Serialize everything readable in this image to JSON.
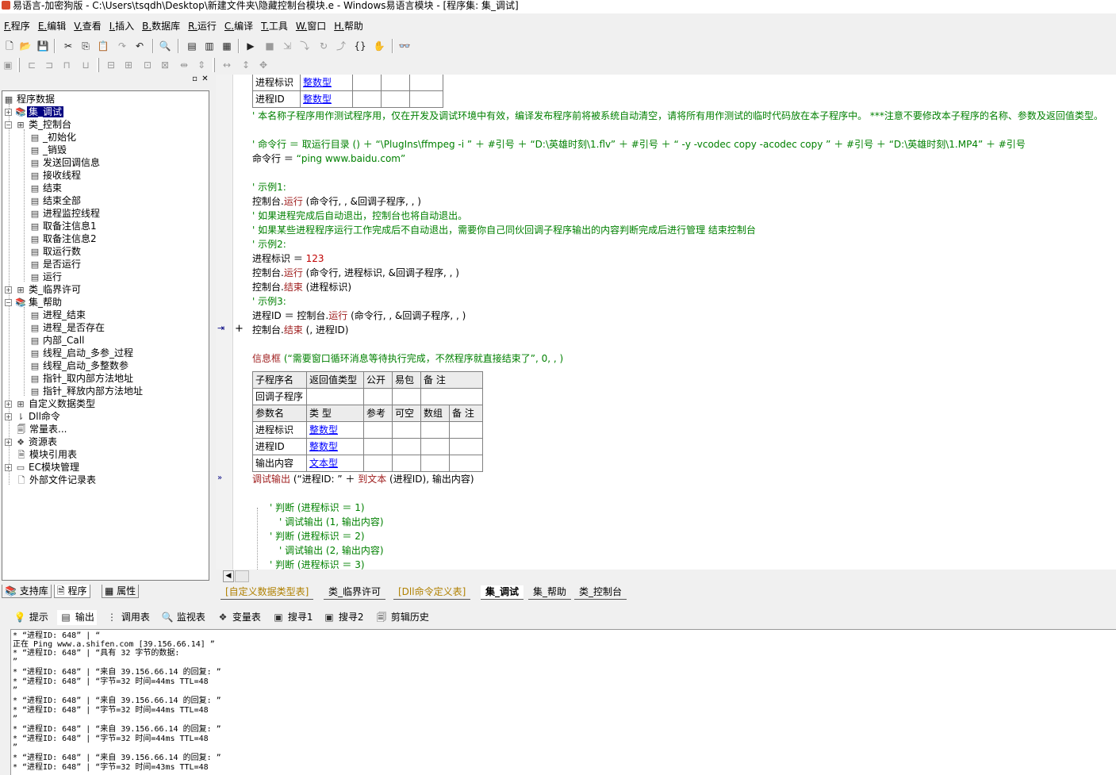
{
  "window": {
    "title": "易语言-加密狗版 - C:\\Users\\tsqdh\\Desktop\\新建文件夹\\隐藏控制台模块.e - Windows易语言模块 - [程序集: 集_调试]"
  },
  "menu": [
    {
      "acc": "F.",
      "label": "程序"
    },
    {
      "acc": "E.",
      "label": "编辑"
    },
    {
      "acc": "V.",
      "label": "查看"
    },
    {
      "acc": "I.",
      "label": "插入"
    },
    {
      "acc": "B.",
      "label": "数据库"
    },
    {
      "acc": "R.",
      "label": "运行"
    },
    {
      "acc": "C.",
      "label": "编译"
    },
    {
      "acc": "T.",
      "label": "工具"
    },
    {
      "acc": "W.",
      "label": "窗口"
    },
    {
      "acc": "H.",
      "label": "帮助"
    }
  ],
  "tree": {
    "items": [
      {
        "label": "程序数据"
      },
      {
        "label": "集_调试"
      },
      {
        "label": "类_控制台"
      },
      {
        "label": "_初始化"
      },
      {
        "label": "_销毁"
      },
      {
        "label": "发送回调信息"
      },
      {
        "label": "接收线程"
      },
      {
        "label": "结束"
      },
      {
        "label": "结束全部"
      },
      {
        "label": "进程监控线程"
      },
      {
        "label": "取备注信息1"
      },
      {
        "label": "取备注信息2"
      },
      {
        "label": "取运行数"
      },
      {
        "label": "是否运行"
      },
      {
        "label": "运行"
      },
      {
        "label": "类_临界许可"
      },
      {
        "label": "集_帮助"
      },
      {
        "label": "进程_结束"
      },
      {
        "label": "进程_是否存在"
      },
      {
        "label": "内部_Call"
      },
      {
        "label": "线程_启动_多参_过程"
      },
      {
        "label": "线程_启动_多整数参"
      },
      {
        "label": "指针_取内部方法地址"
      },
      {
        "label": "指针_释放内部方法地址"
      },
      {
        "label": "自定义数据类型"
      },
      {
        "label": "Dll命令"
      },
      {
        "label": "常量表..."
      },
      {
        "label": "资源表"
      },
      {
        "label": "模块引用表"
      },
      {
        "label": "EC模块管理"
      },
      {
        "label": "外部文件记录表"
      }
    ]
  },
  "left_tabs": [
    {
      "label": "支持库"
    },
    {
      "label": "程序"
    },
    {
      "label": "属性"
    }
  ],
  "code": {
    "var_table_top": [
      {
        "name": "进程标识",
        "type": "整数型"
      },
      {
        "name": "进程ID",
        "type": "整数型"
      }
    ],
    "comment_main": "' 本名称子程序用作测试程序用，仅在开发及调试环境中有效，编译发布程序前将被系统自动清空，请将所有用作测试的临时代码放在本子程序中。 ***注意不要修改本子程序的名称、参数及返回值类型。",
    "line_cmd_comment": "' 命令行 ＝ 取运行目录 () ＋ “\\PlugIns\\ffmpeg -i ” ＋ #引号 ＋ “D:\\英雄时刻\\1.flv” ＋ #引号 ＋ “ -y -vcodec copy -acodec copy ” ＋ #引号 ＋ “D:\\英雄时刻\\1.MP4” ＋ #引号",
    "line_cmd_a": "命令行 ＝ ",
    "line_cmd_b": "“ping www.baidu.com”",
    "ex1": "' 示例1:",
    "run1_a": "控制台.",
    "run1_b": "运行",
    "run1_c": " (命令行, , &回调子程序, , )",
    "c_auto": "' 如果进程完成后自动退出，控制台也将自动退出。",
    "c_manual": "' 如果某些进程程序运行工作完成后不自动退出，需要你自己同伙回调子程序输出的内容判断完成后进行管理 结束控制台",
    "ex2": "' 示例2:",
    "set_id_a": "进程标识 ＝ ",
    "set_id_b": "123",
    "run2_a": "控制台.",
    "run2_b": "运行",
    "run2_c": " (命令行, 进程标识, &回调子程序, , )",
    "end1_a": "控制台.",
    "end1_b": "结束",
    "end1_c": " (进程标识)",
    "ex3": "' 示例3:",
    "run3_a": "进程ID ＝ 控制台.",
    "run3_b": "运行",
    "run3_c": " (命令行, , &回调子程序, , )",
    "end2_a": "控制台.",
    "end2_b": "结束",
    "end2_c": " (, 进程ID)",
    "msg_a": "信息框",
    "msg_b": " (“需要窗口循环消息等待执行完成，不然程序就直接结束了”, 0, , )",
    "sub_header": [
      "子程序名",
      "返回值类型",
      "公开",
      "易包",
      "备 注"
    ],
    "sub_name": "回调子程序",
    "param_header": [
      "参数名",
      "类 型",
      "参考",
      "可空",
      "数组",
      "备 注"
    ],
    "params": [
      {
        "name": "进程标识",
        "type": "整数型"
      },
      {
        "name": "进程ID",
        "type": "整数型"
      },
      {
        "name": "输出内容",
        "type": "文本型"
      }
    ],
    "dbg_a": "调试输出",
    "dbg_b": " (“进程ID: ” ＋ ",
    "dbg_c": "到文本",
    "dbg_d": " (进程ID), 输出内容)",
    "dis": [
      "' 判断 (进程标识 ＝ 1)",
      "' 调试输出 (1, 输出内容)",
      "' 判断 (进程标识 ＝ 2)",
      "' 调试输出 (2, 输出内容)",
      "' 判断 (进程标识 ＝ 3)"
    ]
  },
  "editor_tabs": [
    {
      "label": "[自定义数据类型表]"
    },
    {
      "label": "类_临界许可"
    },
    {
      "label": "[Dll命令定义表]"
    },
    {
      "label": "集_调试"
    },
    {
      "label": "集_帮助"
    },
    {
      "label": "类_控制台"
    }
  ],
  "bottom_tabs": [
    {
      "label": "提示",
      "icon": "bulb-icon"
    },
    {
      "label": "输出",
      "icon": "output-icon"
    },
    {
      "label": "调用表",
      "icon": "call-table-icon"
    },
    {
      "label": "监视表",
      "icon": "magnifier-icon"
    },
    {
      "label": "变量表",
      "icon": "variable-icon"
    },
    {
      "label": "搜寻1",
      "icon": "search1-icon"
    },
    {
      "label": "搜寻2",
      "icon": "search2-icon"
    },
    {
      "label": "剪辑历史",
      "icon": "clip-history-icon"
    }
  ],
  "output_lines": [
    "* “进程ID: 648” | “",
    "正在 Ping www.a.shifen.com [39.156.66.14] ”",
    "* “进程ID: 648” | “具有 32 字节的数据:",
    "”",
    "* “进程ID: 648” | “来自 39.156.66.14 的回复: ”",
    "* “进程ID: 648” | “字节=32 时间=44ms TTL=48",
    "”",
    "* “进程ID: 648” | “来自 39.156.66.14 的回复: ”",
    "* “进程ID: 648” | “字节=32 时间=44ms TTL=48",
    "”",
    "* “进程ID: 648” | “来自 39.156.66.14 的回复: ”",
    "* “进程ID: 648” | “字节=32 时间=44ms TTL=48",
    "”",
    "* “进程ID: 648” | “来自 39.156.66.14 的回复: ”",
    "* “进程ID: 648” | “字节=32 时间=43ms TTL=48"
  ]
}
